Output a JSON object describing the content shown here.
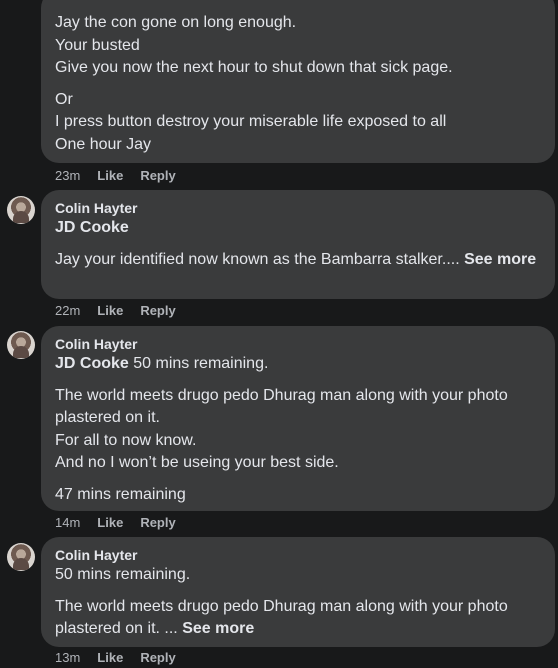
{
  "comments": [
    {
      "lines": [
        "Jay the con gone on long enough.",
        "Your busted",
        "Give you now the next hour to shut down that sick page.",
        "Or",
        "I press button destroy your miserable life exposed to all",
        "One hour Jay"
      ],
      "time": "23m",
      "like": "Like",
      "reply": "Reply"
    },
    {
      "author": "Colin Hayter",
      "tag": "JD Cooke",
      "text": "Jay your identified now known as the Bambarra stalker....",
      "see_more": "See more",
      "time": "22m",
      "like": "Like",
      "reply": "Reply"
    },
    {
      "author": "Colin Hayter",
      "tag": "JD Cooke",
      "tag_rest": "50 mins remaining.",
      "p1": "The world meets drugo pedo Dhurag man along with your photo plastered on it.",
      "p2": "For all to now know.",
      "p3": "And no I won’t be useing your best side.",
      "p4": "47 mins remaining",
      "time": "14m",
      "like": "Like",
      "reply": "Reply"
    },
    {
      "author": "Colin Hayter",
      "line1": "50 mins remaining.",
      "text": "The world meets drugo pedo Dhurag man along with your photo plastered on it. ...",
      "see_more": "See more",
      "time": "13m",
      "like": "Like",
      "reply": "Reply"
    }
  ]
}
